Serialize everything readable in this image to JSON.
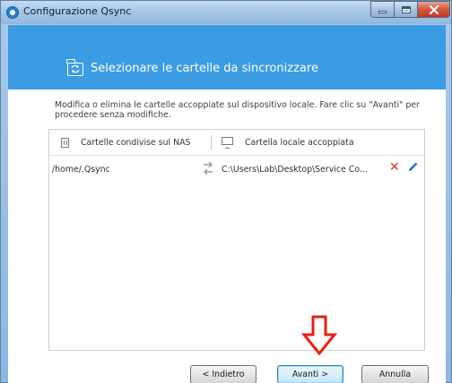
{
  "window": {
    "title": "Configurazione Qsync"
  },
  "banner": {
    "title": "Selezionare le cartelle da sincronizzare",
    "background_color": "#3b9be3"
  },
  "description": "Modifica o elimina le cartelle accoppiate sul dispositivo locale. Fare clic su \"Avanti\" per procedere senza modifiche.",
  "table": {
    "columns": [
      "Cartelle condivise sul NAS",
      "Cartella locale accoppiata"
    ],
    "rows": [
      {
        "nas_path": "/home/.Qsync",
        "local_path": "C:\\Users\\Lab\\Desktop\\Service Co..."
      }
    ]
  },
  "buttons": {
    "back": "< Indietro",
    "next": "Avanti >",
    "cancel": "Annulla"
  },
  "colors": {
    "accent": "#3b9be3",
    "delete": "#e0321b",
    "edit": "#2f7fd0",
    "annotation_arrow": "#e8200f"
  },
  "icons": [
    "qsync-app-icon",
    "folder-sync-icon",
    "nas-server-icon",
    "monitor-icon",
    "sync-arrows-icon",
    "delete-icon",
    "edit-pencil-icon",
    "red-arrow-down-icon"
  ]
}
